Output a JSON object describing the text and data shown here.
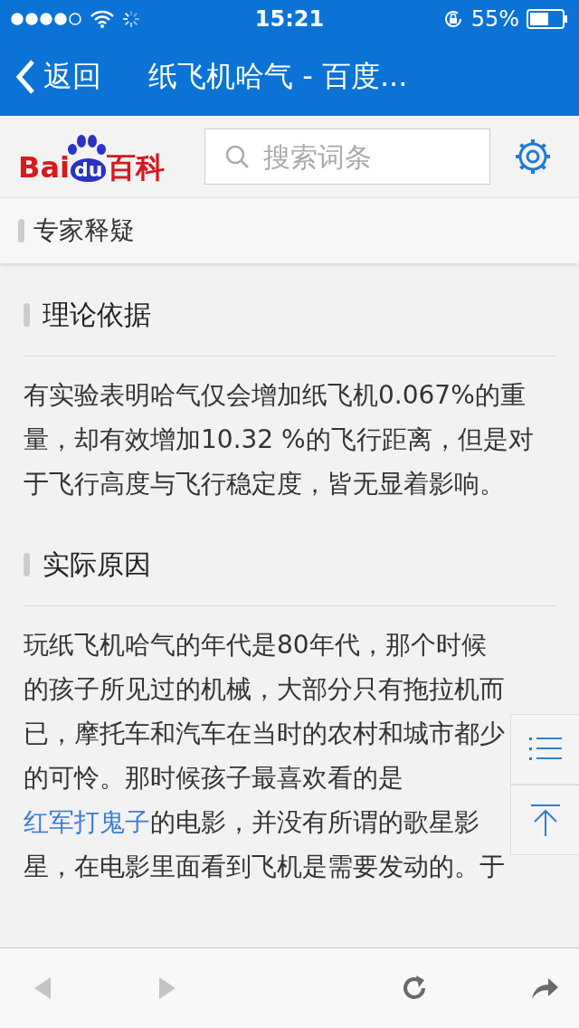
{
  "status_bar": {
    "time": "15:21",
    "battery": "55%"
  },
  "nav_bar": {
    "back": "返回",
    "title": "纸飞机哈气 - 百度..."
  },
  "header": {
    "logo": {
      "left": "Bai",
      "middle": "du",
      "right": "百科"
    },
    "search": {
      "placeholder": "搜索词条"
    }
  },
  "sticky_section": {
    "title": "专家释疑"
  },
  "sections": [
    {
      "title": "理论依据",
      "paragraph": [
        {
          "kind": "text",
          "text": "有实验表明哈气仅会增加纸飞机0.067%的重量，却有效增加10.32 %的飞行距离，但是对于飞行高度与飞行稳定度，皆无显着影响。"
        }
      ]
    },
    {
      "title": "实际原因",
      "paragraph": [
        {
          "kind": "text",
          "text": "玩纸飞机哈气的年代是80年代，那个时候的孩子所见过的机械，大部分只有拖拉机而已，摩托车和汽车在当时的农村和城市都少的可怜。那时候孩子最喜欢看的是"
        },
        {
          "kind": "link",
          "text": "红军打鬼子"
        },
        {
          "kind": "text",
          "text": "的电影，并没有所谓的歌星影星，在电影里面看到飞机是需要发动的。于"
        }
      ]
    }
  ],
  "toolbar": {
    "back_disabled": true,
    "forward_disabled": true
  }
}
